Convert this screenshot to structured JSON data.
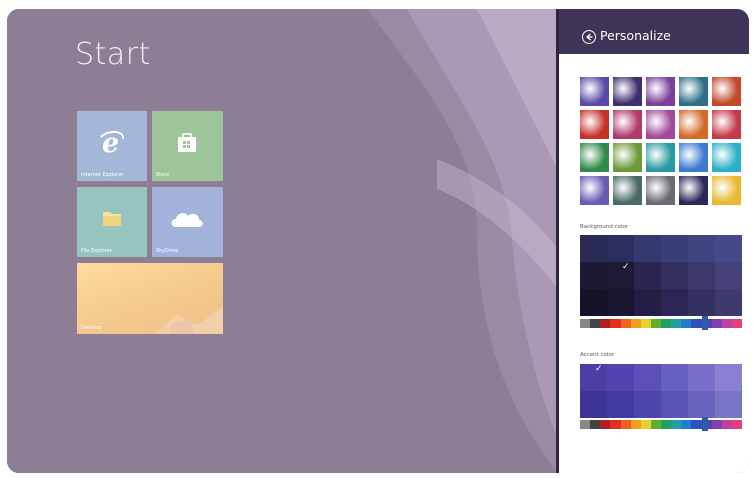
{
  "start": {
    "title": "Start",
    "tiles": [
      {
        "name": "internet-explorer",
        "label": "Internet Explorer",
        "icon": "internet-explorer-icon"
      },
      {
        "name": "store",
        "label": "Store",
        "icon": "store-icon"
      },
      {
        "name": "file-explorer",
        "label": "File Explorer",
        "icon": "folder-icon"
      },
      {
        "name": "skydrive",
        "label": "SkyDrive",
        "icon": "cloud-icon"
      },
      {
        "name": "desktop",
        "label": "Desktop",
        "icon": "desktop-wallpaper"
      }
    ]
  },
  "pane": {
    "title": "Personalize",
    "back_icon": "back-arrow-icon",
    "background_color_label": "Background color",
    "accent_color_label": "Accent color"
  },
  "colors": {
    "pane_header": "#3f3457",
    "start_background": "#8d7e95",
    "selected_background": "#1f1a33",
    "selected_accent": "#4a3fa4"
  },
  "patterns": [
    "#5a4aa6",
    "#3f2e70",
    "#7a3f9a",
    "#2f6f8a",
    "#c04a2a",
    "#c8302a",
    "#b03a6a",
    "#a24a9a",
    "#d46a2a",
    "#c43a4a",
    "#2f8a4a",
    "#6a9a3a",
    "#2a9aa0",
    "#3a7ad0",
    "#2ab0c8",
    "#6a5ab0",
    "#4a6a6a",
    "#6a6a70",
    "#2a2a5a",
    "#e8b830"
  ],
  "background_swatches": [
    [
      "#2a2b55",
      "#2d2e60",
      "#353a6e",
      "#3a3e78",
      "#404480",
      "#45498a"
    ],
    [
      "#1c1a33",
      "#1f1a33",
      "#2a2550",
      "#33305f",
      "#3b386c",
      "#45427a"
    ],
    [
      "#15122a",
      "#1a1630",
      "#241e45",
      "#2c2655",
      "#353062",
      "#3e3a6e"
    ]
  ],
  "accent_swatches": [
    [
      "#4a3fa4",
      "#4f44b0",
      "#5a50b8",
      "#6860c0",
      "#7870c8",
      "#8880d0"
    ],
    [
      "#3d3595",
      "#433aa2",
      "#4e46ac",
      "#5b54b6",
      "#6a64bd",
      "#7a75c5"
    ]
  ],
  "spectrum": [
    "#888888",
    "#444444",
    "#b02020",
    "#e03020",
    "#f06020",
    "#f0a020",
    "#e8d030",
    "#60b030",
    "#20a060",
    "#20a0a0",
    "#2080d0",
    "#3050c0",
    "#5040b0",
    "#8040b0",
    "#c040a0",
    "#e04080"
  ]
}
